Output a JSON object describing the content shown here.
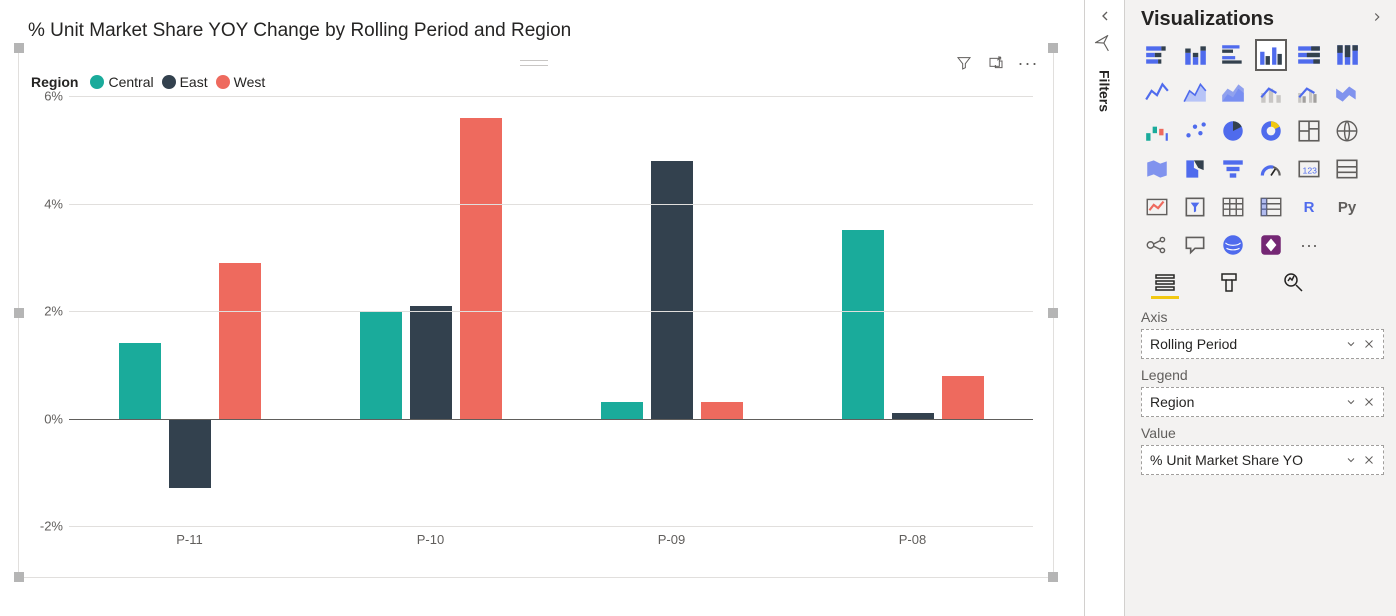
{
  "chart_data": {
    "type": "bar",
    "title": "% Unit Market Share YOY Change by Rolling Period and Region",
    "categories": [
      "P-11",
      "P-10",
      "P-09",
      "P-08"
    ],
    "series": [
      {
        "name": "Central",
        "color": "#1aab9b",
        "values": [
          1.4,
          2.0,
          0.3,
          3.5
        ]
      },
      {
        "name": "East",
        "color": "#33414e",
        "values": [
          -1.3,
          2.1,
          4.8,
          0.1
        ]
      },
      {
        "name": "West",
        "color": "#ee6a5e",
        "values": [
          2.9,
          5.6,
          0.3,
          0.8
        ]
      }
    ],
    "xlabel": "",
    "ylabel": "",
    "ylim": [
      -2,
      6
    ],
    "y_ticks": [
      -2,
      0,
      2,
      4,
      6
    ],
    "legend_title": "Region"
  },
  "filters": {
    "label": "Filters"
  },
  "viz_pane": {
    "title": "Visualizations",
    "sections": {
      "axis": {
        "label": "Axis",
        "value": "Rolling Period"
      },
      "legend": {
        "label": "Legend",
        "value": "Region"
      },
      "value": {
        "label": "Value",
        "value": "% Unit Market Share YO"
      }
    }
  }
}
